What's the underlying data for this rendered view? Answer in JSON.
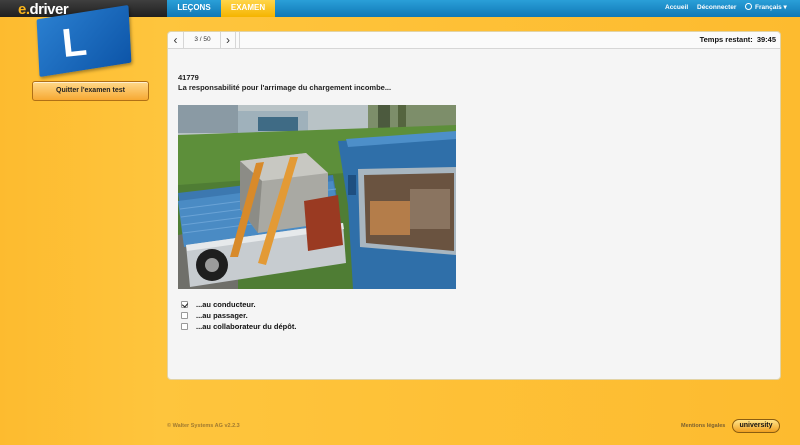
{
  "brand": {
    "prefix": "e.",
    "name": "driver",
    "logo_letter": "L"
  },
  "nav": {
    "tabs": [
      {
        "label": "LEÇONS",
        "active": false
      },
      {
        "label": "EXAMEN",
        "active": true
      }
    ],
    "links": {
      "home": "Accueil",
      "logout": "Déconnecter",
      "language": "Français ▾"
    }
  },
  "sidebar": {
    "quit_label": "Quitter l'examen test"
  },
  "toolbar": {
    "prev_icon": "‹",
    "next_icon": "›",
    "page": "3 / 50",
    "timer_label": "Temps restant:",
    "timer_value": "39:45"
  },
  "question": {
    "id": "41779",
    "text": "La responsabilité pour l'arrimage du chargement incombe...",
    "image_subject": "pickup-truck-with-strapped-load"
  },
  "answers": [
    {
      "label": "...au conducteur.",
      "checked": true
    },
    {
      "label": "...au passager.",
      "checked": false
    },
    {
      "label": "...au collaborateur du dépôt.",
      "checked": false
    }
  ],
  "footer": {
    "copyright": "© Walter Systems AG   v2.2.3",
    "legal": "Mentions légales",
    "badge": "university"
  },
  "colors": {
    "background": "#fdbb2f",
    "nav_blue": "#1a8bcb",
    "active_tab": "#f5b400",
    "flag_blue": "#1565b8"
  }
}
